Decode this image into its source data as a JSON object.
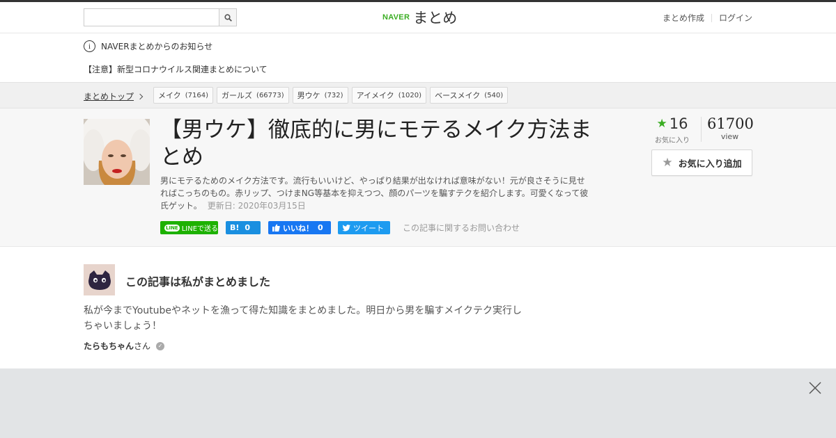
{
  "header": {
    "search_placeholder": "",
    "logo_brand": "NAVER",
    "logo_name": "まとめ",
    "links": [
      "まとめ作成",
      "ログイン"
    ]
  },
  "notice": {
    "title": "NAVERまとめからのお知らせ",
    "link": "【注意】新型コロナウイルス関連まとめについて"
  },
  "breadcrumb": {
    "top": "まとめトップ",
    "tags": [
      {
        "label": "メイク",
        "count": "(7164)"
      },
      {
        "label": "ガールズ",
        "count": "(66773)"
      },
      {
        "label": "男ウケ",
        "count": "(732)"
      },
      {
        "label": "アイメイク",
        "count": "(1020)"
      },
      {
        "label": "ベースメイク",
        "count": "(540)"
      }
    ]
  },
  "article": {
    "title": "【男ウケ】徹底的に男にモテるメイク方法まとめ",
    "description": "男にモテるためのメイク方法です。流行もいいけど、やっぱり結果が出なければ意味がない！元が良さそうに見せればこっちのもの。赤リップ、つけまNG等基本を抑えつつ、顔のパーツを騙すテクを紹介します。可愛くなって彼氏ゲット。",
    "updated": "更新日: 2020年03月15日",
    "share": {
      "line": "LINEで送る",
      "line_badge": "LINE",
      "hatena": "B!",
      "hatena_count": "0",
      "fb": "いいね！",
      "fb_count": "0",
      "tweet": "ツイート"
    },
    "inquiry": "この記事に関するお問い合わせ",
    "favorites": "16",
    "favorites_label": "お気に入り",
    "views": "61700",
    "views_label": "view",
    "fav_button": "お気に入り追加"
  },
  "author": {
    "heading": "この記事は私がまとめました",
    "text": "私が今までYoutubeやネットを漁って得た知識をまとめました。明日から男を騙すメイクテク実行しちゃいましょう！",
    "name": "たらもちゃん",
    "suffix": "さん"
  },
  "colors": {
    "brand_green": "#3aad22",
    "line_green": "#1db100",
    "hatena_blue": "#1a8fe0",
    "facebook_blue": "#1877f2",
    "twitter_blue": "#1d9bf0"
  }
}
